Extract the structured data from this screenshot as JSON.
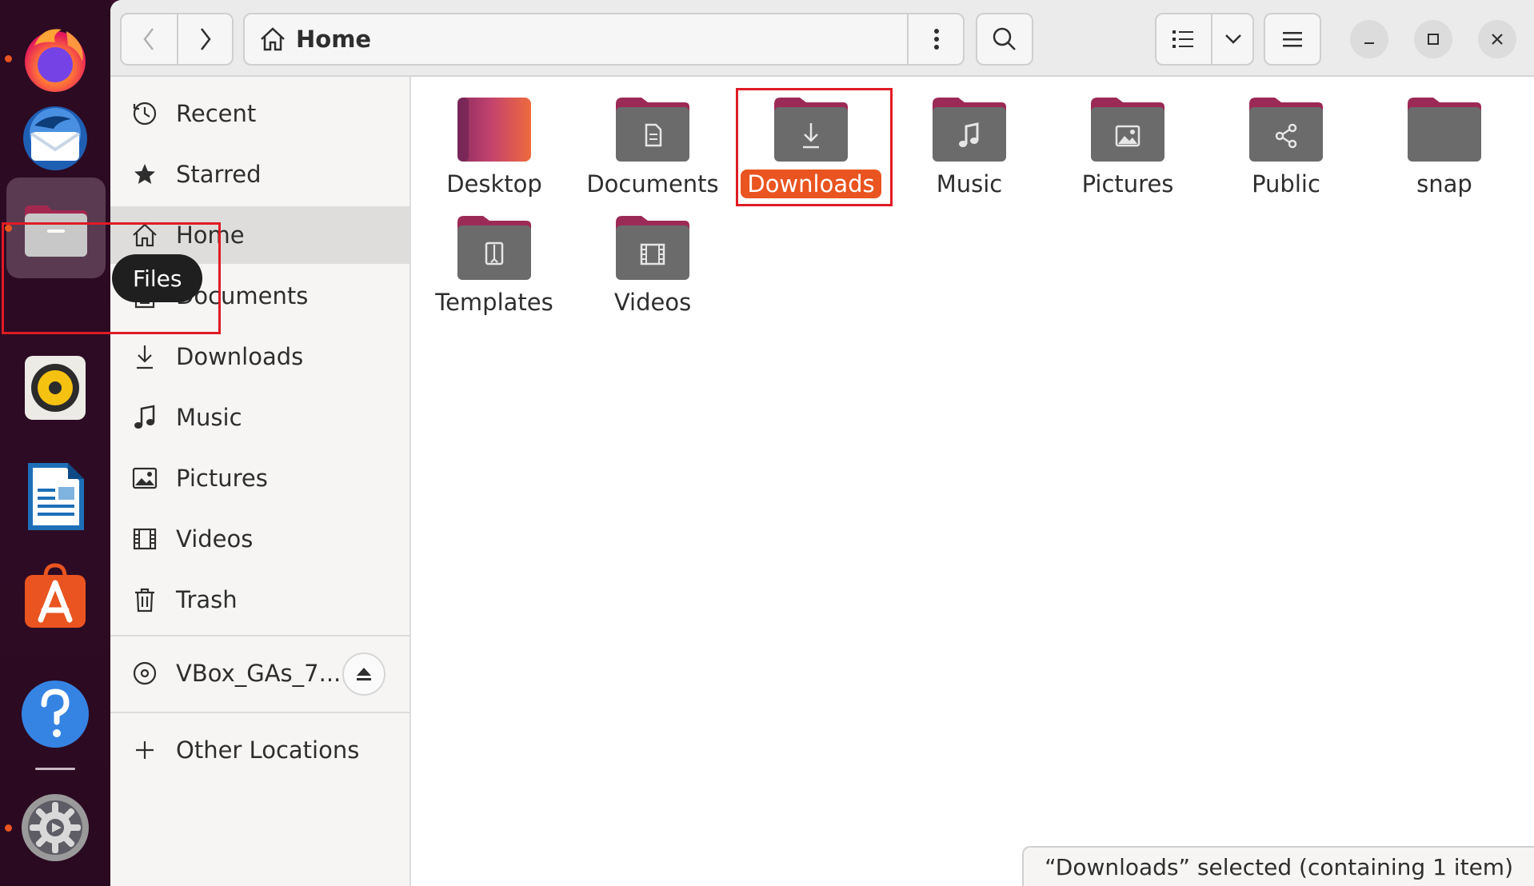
{
  "dock": {
    "items": [
      {
        "name": "firefox",
        "icon": "firefox-icon",
        "running": true
      },
      {
        "name": "thunderbird",
        "icon": "thunderbird-icon",
        "running": false
      },
      {
        "name": "files",
        "icon": "files-icon",
        "running": true,
        "active": true
      },
      {
        "name": "rhythmbox",
        "icon": "rhythmbox-icon",
        "running": false
      },
      {
        "name": "libreoffice-writer",
        "icon": "writer-icon",
        "running": false
      },
      {
        "name": "app-center",
        "icon": "app-center-icon",
        "running": false
      },
      {
        "name": "help",
        "icon": "help-icon",
        "running": false
      },
      {
        "name": "settings",
        "icon": "settings-icon",
        "running": true
      }
    ],
    "tooltip": "Files"
  },
  "headerbar": {
    "path_label": "Home",
    "icons": {
      "back": "back-arrow-icon",
      "forward": "forward-arrow-icon",
      "home": "home-icon",
      "more": "vertical-dots-icon",
      "search": "search-icon",
      "list_view": "list-view-icon",
      "view_options": "chevron-down-icon",
      "menu": "hamburger-menu-icon"
    }
  },
  "sidebar": {
    "places": [
      {
        "label": "Recent",
        "icon": "clock-icon"
      },
      {
        "label": "Starred",
        "icon": "star-icon"
      },
      {
        "label": "Home",
        "icon": "home-icon",
        "selected": true
      },
      {
        "label": "Documents",
        "icon": "document-icon"
      },
      {
        "label": "Downloads",
        "icon": "download-icon"
      },
      {
        "label": "Music",
        "icon": "music-note-icon"
      },
      {
        "label": "Pictures",
        "icon": "picture-icon"
      },
      {
        "label": "Videos",
        "icon": "film-icon"
      },
      {
        "label": "Trash",
        "icon": "trash-icon"
      }
    ],
    "devices": [
      {
        "label": "VBox_GAs_7....",
        "icon": "disc-icon",
        "eject_icon": "eject-icon"
      }
    ],
    "other_locations": {
      "label": "Other Locations",
      "icon": "plus-icon"
    }
  },
  "content": {
    "items": [
      {
        "label": "Desktop",
        "type": "desktop-folder"
      },
      {
        "label": "Documents",
        "type": "documents-folder"
      },
      {
        "label": "Downloads",
        "type": "downloads-folder",
        "selected": true
      },
      {
        "label": "Music",
        "type": "music-folder"
      },
      {
        "label": "Pictures",
        "type": "pictures-folder"
      },
      {
        "label": "Public",
        "type": "public-folder"
      },
      {
        "label": "snap",
        "type": "plain-folder"
      },
      {
        "label": "Templates",
        "type": "templates-folder"
      },
      {
        "label": "Videos",
        "type": "videos-folder"
      }
    ]
  },
  "statusbar": {
    "text": "“Downloads” selected  (containing 1 item)"
  },
  "colors": {
    "accent": "#e95420",
    "highlight_box": "#e01b24",
    "folder_body": "#6b6b6b",
    "folder_tab": "#9c2a56"
  }
}
